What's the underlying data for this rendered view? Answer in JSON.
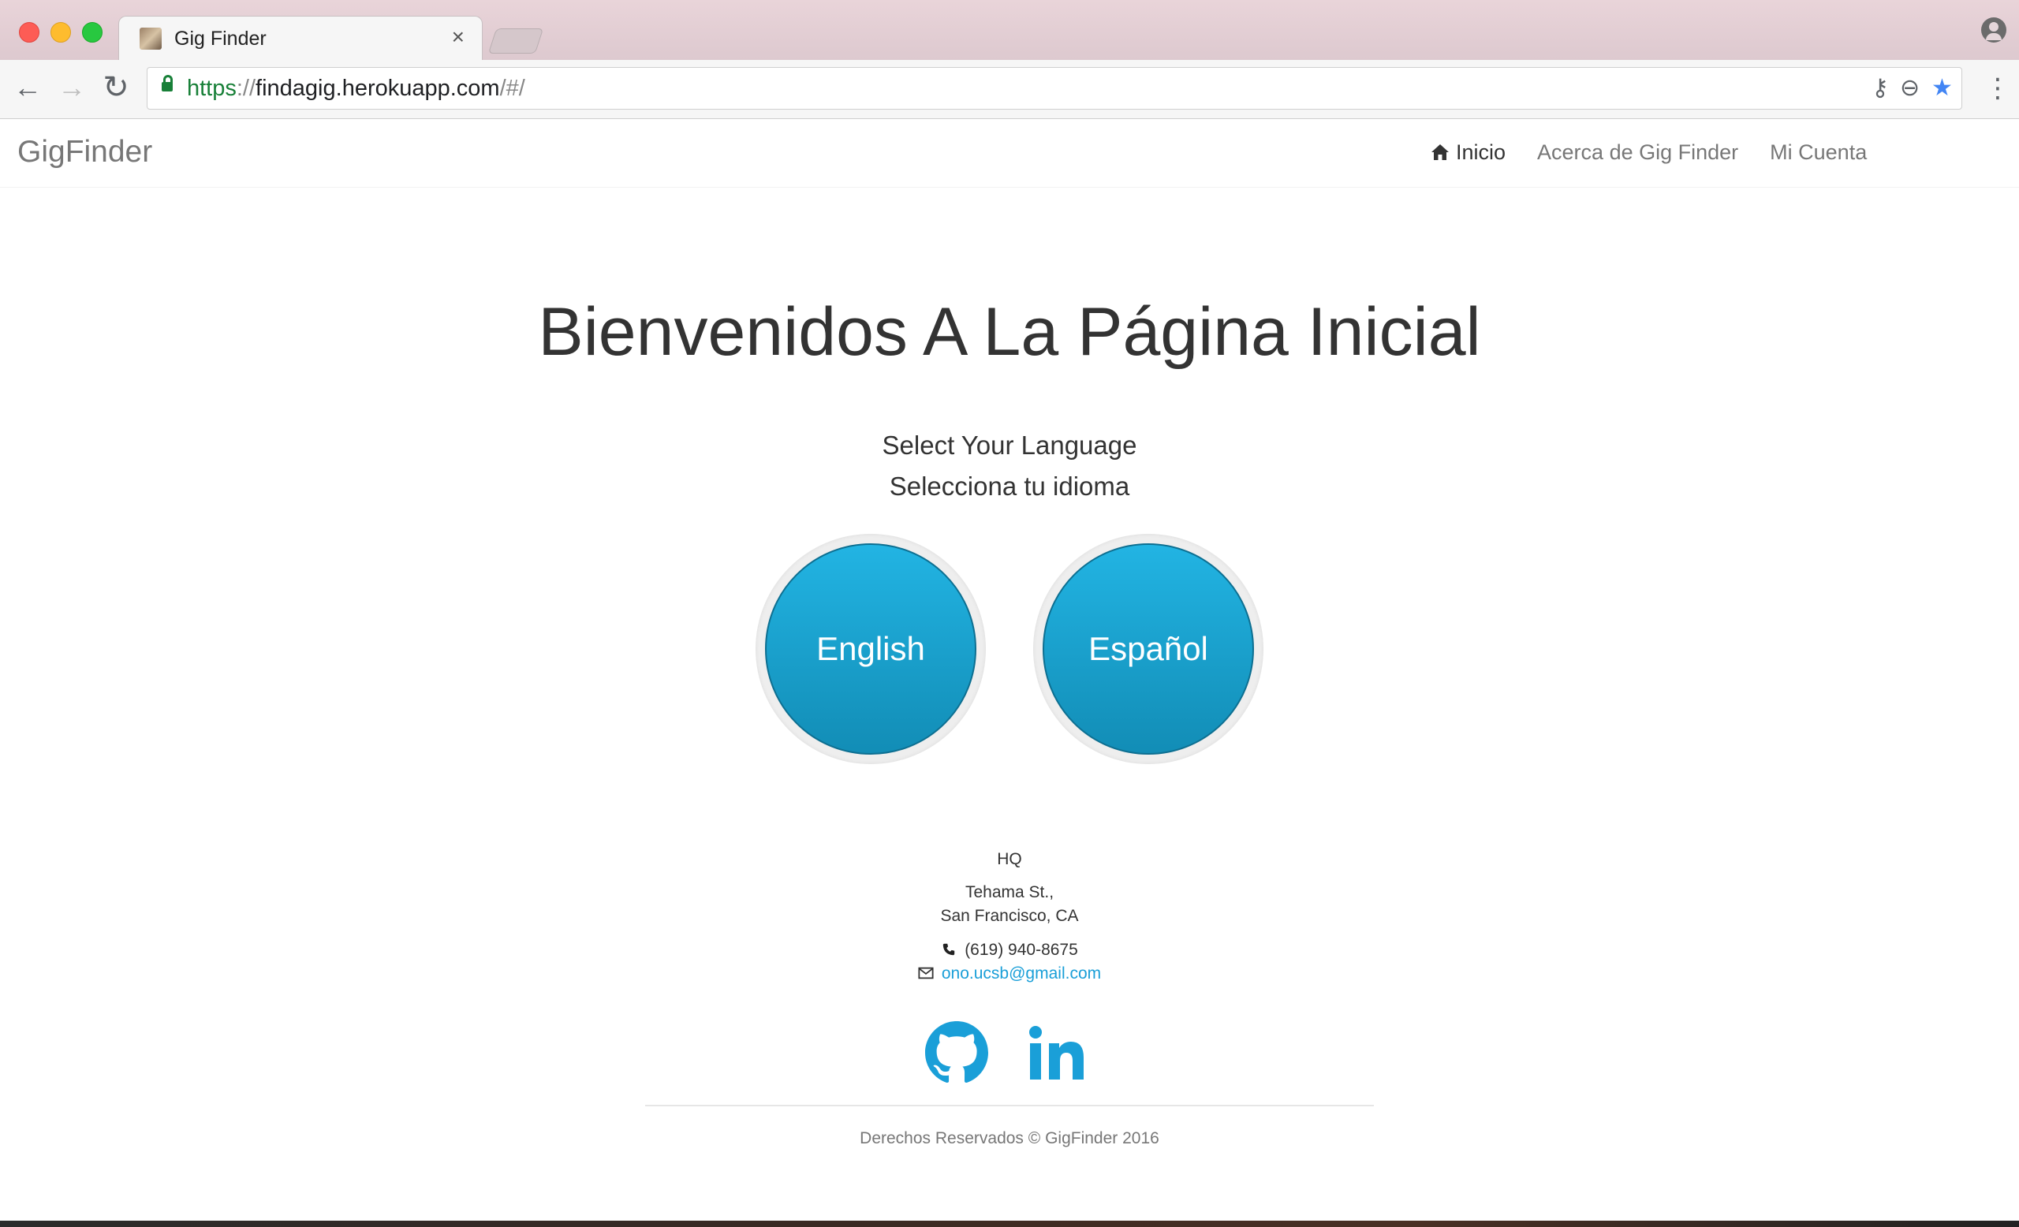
{
  "browser": {
    "tab_title": "Gig Finder",
    "tab_close": "×",
    "url_scheme": "https",
    "url_sep": "://",
    "url_host": "findagig.herokuapp.com",
    "url_path": "/#/",
    "icons": [
      "back-arrow-icon",
      "forward-arrow-icon",
      "reload-icon",
      "lock-icon",
      "key-icon",
      "zoom-icon",
      "star-icon",
      "menu-icon",
      "profile-icon"
    ],
    "colors": {
      "secure": "#188038",
      "star": "#4285f4",
      "tabstrip": "#e4d0d5"
    }
  },
  "navbar": {
    "brand": "GigFinder",
    "links": [
      {
        "label": "Inicio",
        "active": true,
        "icon": "home-icon"
      },
      {
        "label": "Acerca de Gig Finder",
        "active": false
      },
      {
        "label": "Mi Cuenta",
        "active": false
      }
    ]
  },
  "main": {
    "heading": "Bienvenidos A La Página Inicial",
    "select_en": "Select Your Language",
    "select_es": "Selecciona tu idioma",
    "buttons": {
      "english": "English",
      "spanish": "Español"
    },
    "button_color": "#1ba7d6"
  },
  "footer": {
    "hq": "HQ",
    "street": "Tehama St.,",
    "city": "San Francisco, CA",
    "phone": "(619) 940-8675",
    "email": "ono.ucsb@gmail.com",
    "social": [
      "github-icon",
      "linkedin-icon"
    ],
    "copyright": "Derechos Reservados © GigFinder 2016",
    "link_color": "#1a9fd8"
  }
}
